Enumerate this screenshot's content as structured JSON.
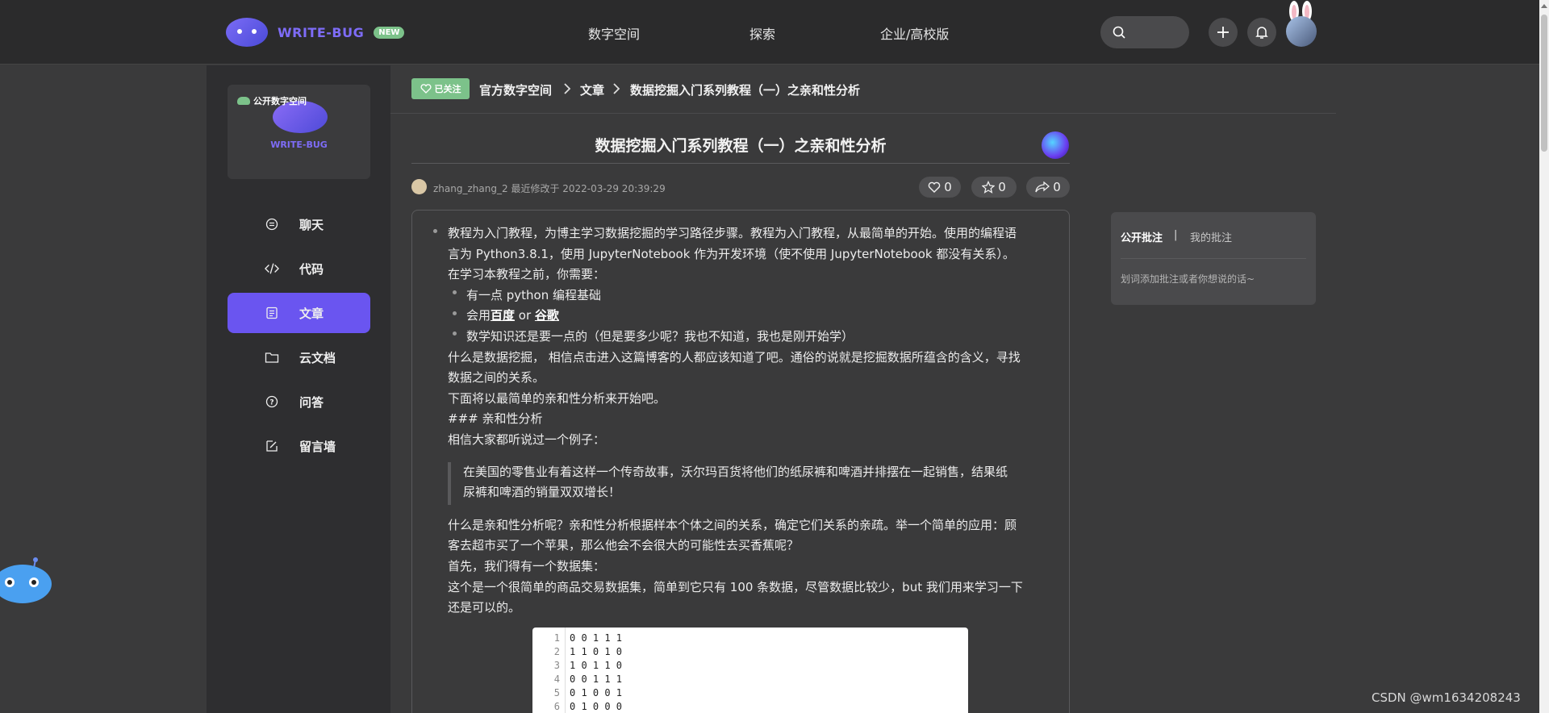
{
  "header": {
    "brand": "WRITE-BUG",
    "badge": "NEW",
    "nav": [
      "数字空间",
      "探索",
      "企业/高校版"
    ]
  },
  "sidebar": {
    "space_tag": "公开数字空间",
    "space_name": "WRITE-BUG",
    "items": [
      {
        "label": "聊天",
        "icon": "chat-icon"
      },
      {
        "label": "代码",
        "icon": "code-icon"
      },
      {
        "label": "文章",
        "icon": "article-icon"
      },
      {
        "label": "云文档",
        "icon": "folder-icon"
      },
      {
        "label": "问答",
        "icon": "question-icon"
      },
      {
        "label": "留言墙",
        "icon": "edit-icon"
      }
    ],
    "active_index": 2
  },
  "breadcrumb": {
    "follow_label": "已关注",
    "items": [
      "官方数字空间",
      "文章",
      "数据挖掘入门系列教程（一）之亲和性分析"
    ]
  },
  "article": {
    "title": "数据挖掘入门系列教程（一）之亲和性分析",
    "author": "zhang_zhang_2",
    "modified_text": "最近修改于 2022-03-29 20:39:29",
    "likes": "0",
    "stars": "0",
    "shares": "0",
    "lines": {
      "l1": "教程为入门教程，为博主学习数据挖掘的学习路径步骤。教程为入门教程，从最简单的开始。使用的编程语",
      "l2": "言为 Python3.8.1，使用 JupyterNotebook 作为开发环境（使不使用 JupyterNotebook 都没有关系）。",
      "l3": "在学习本教程之前，你需要：",
      "b1": "有一点 python 编程基础",
      "b2_pre": "会用",
      "b2_link1": "百度",
      "b2_mid": " or ",
      "b2_link2": "谷歌",
      "b3": "数学知识还是要一点的（但是要多少呢？我也不知道，我也是刚开始学）",
      "l4": "什么是数据挖掘， 相信点击进入这篇博客的人都应该知道了吧。通俗的说就是挖掘数据所蕴含的含义，寻找",
      "l5": "数据之间的关系。",
      "l6": "下面将以最简单的亲和性分析来开始吧。",
      "l7": "### 亲和性分析",
      "l8": "相信大家都听说过一个例子：",
      "q1": "在美国的零售业有着这样一个传奇故事，沃尔玛百货将他们的纸尿裤和啤酒并排摆在一起销售，结果纸",
      "q2": "尿裤和啤酒的销量双双增长！",
      "l9": "什么是亲和性分析呢？亲和性分析根据样本个体之间的关系，确定它们关系的亲疏。举一个简单的应用：顾",
      "l10": "客去超市买了一个苹果，那么他会不会很大的可能性去买香蕉呢？",
      "l11": "首先，我们得有一个数据集：",
      "l12": "这个是一个很简单的商品交易数据集，简单到它只有 100 条数据，尽管数据比较少，but 我们用来学习一下",
      "l13": "还是可以的。"
    },
    "code": [
      {
        "n": "1",
        "v": "0 0 1 1 1"
      },
      {
        "n": "2",
        "v": "1 1 0 1 0"
      },
      {
        "n": "3",
        "v": "1 0 1 1 0"
      },
      {
        "n": "4",
        "v": "0 0 1 1 1"
      },
      {
        "n": "5",
        "v": "0 1 0 0 1"
      },
      {
        "n": "6",
        "v": "0 1 0 0 0"
      }
    ]
  },
  "notes": {
    "tab_public": "公开批注",
    "divider": "|",
    "tab_mine": "我的批注",
    "hint": "划词添加批注或者你想说的话~"
  },
  "watermark": "CSDN @wm1634208243"
}
